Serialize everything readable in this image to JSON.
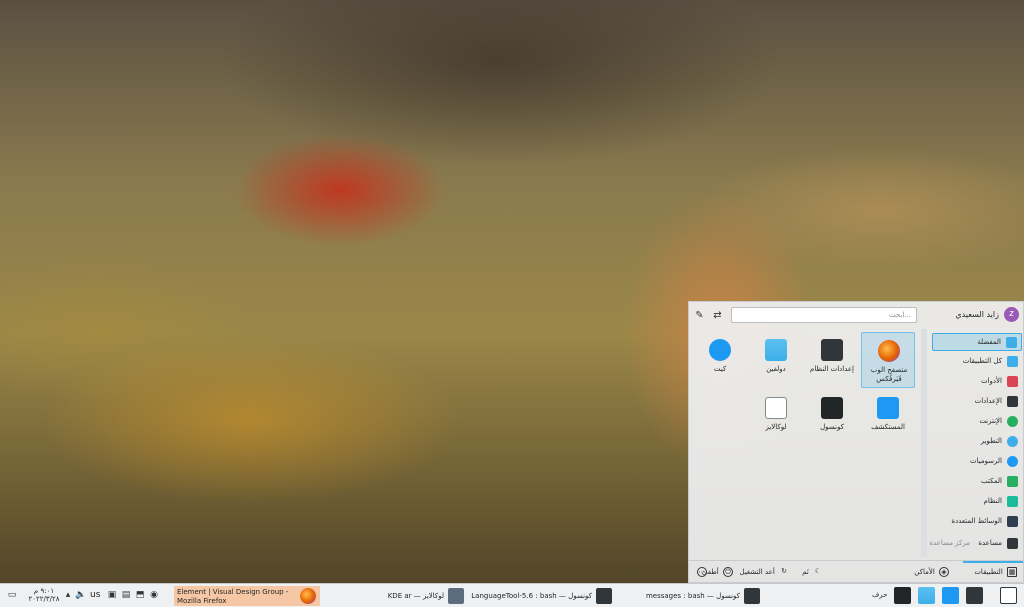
{
  "menu": {
    "user_name": "زايد السعيدي",
    "avatar_letter": "z",
    "search_placeholder": "ابحث...",
    "apps": [
      {
        "label": "متصفح الوب فَيَرفُكس",
        "icon": "firefox-icon",
        "color": "#e66000"
      },
      {
        "label": "إعدادات النظام",
        "icon": "settings-icon",
        "color": "#31363b"
      },
      {
        "label": "دولفين",
        "icon": "folder-icon",
        "color": "#3daee9"
      },
      {
        "label": "كيت",
        "icon": "kate-icon",
        "color": "#1d99f3"
      },
      {
        "label": "المستكشف",
        "icon": "discover-icon",
        "color": "#1d99f3"
      },
      {
        "label": "كونسول",
        "icon": "terminal-icon",
        "color": "#232629"
      },
      {
        "label": "لوكالايز",
        "icon": "lokalize-icon",
        "color": "#ffffff"
      }
    ],
    "categories": [
      {
        "label": "المفضلة",
        "icon": "favorites-icon",
        "color": "#3daee9"
      },
      {
        "label": "كل التطبيقات",
        "icon": "all-apps-icon",
        "color": "#3daee9"
      },
      {
        "label": "الأدوات",
        "icon": "utilities-icon",
        "color": "#da4453"
      },
      {
        "label": "الإعدادات",
        "icon": "settings-category-icon",
        "color": "#31363b"
      },
      {
        "label": "الإنترنت",
        "icon": "internet-icon",
        "color": "#27ae60"
      },
      {
        "label": "التطوير",
        "icon": "development-icon",
        "color": "#3daee9"
      },
      {
        "label": "الرسوميات",
        "icon": "graphics-icon",
        "color": "#1d99f3"
      },
      {
        "label": "المكتب",
        "icon": "office-icon",
        "color": "#27ae60"
      },
      {
        "label": "النظام",
        "icon": "system-icon",
        "color": "#1abc9c"
      },
      {
        "label": "الوسائط المتعددة",
        "icon": "multimedia-icon",
        "color": "#2c3e50"
      },
      {
        "label": "مساعدة",
        "secondary": "مركز مساعدة",
        "icon": "help-icon",
        "color": "#31363b"
      }
    ],
    "footer": {
      "applications": "التطبيقات",
      "places": "الأماكن",
      "sleep": "نَم",
      "restart": "أعد التشغيل",
      "shutdown": "أطفئ"
    }
  },
  "taskbar": {
    "lang": "حرف",
    "tasks": [
      {
        "label": "messages : bash — كونسول",
        "icon": "terminal-icon",
        "color": "#31363b"
      },
      {
        "label": "LanguageTool-5.6 : bash — كونسول",
        "icon": "terminal-icon",
        "color": "#31363b"
      },
      {
        "label": "KDE ar — لوكالايز",
        "icon": "lokalize-icon",
        "color": "#5d6d7e"
      },
      {
        "label": "Element | Visual Design Group - Mozilla Firefox",
        "icon": "firefox-icon",
        "color": "#e66000"
      }
    ],
    "keyboard_layout": "us",
    "clock_time": "٩:٠١ م",
    "clock_date": "٢٠٢٢/٣/٢٨"
  },
  "colors": {
    "accent": "#3daee9",
    "panel": "#eff0f1"
  }
}
